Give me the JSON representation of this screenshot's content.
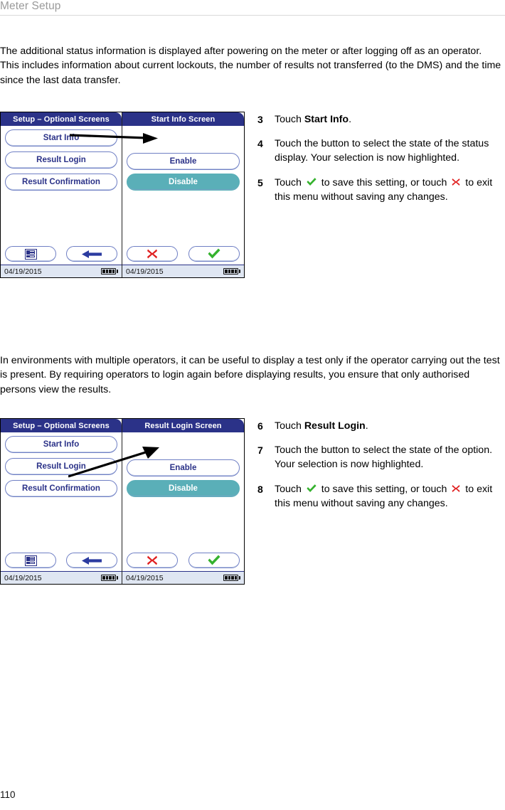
{
  "running_head": "Meter Setup",
  "page_number": "110",
  "paragraphs": {
    "intro": "The additional status information is displayed after powering on the meter or after logging off as an operator. This includes information about current lockouts, the number of results not transferred (to the DMS) and the time since the last data transfer.",
    "middle": "In environments with multiple operators, it can be useful to display a test only if the operator carrying out the test is present. By requiring operators to login again before displaying results, you ensure that only authorised persons view the results."
  },
  "colors": {
    "title_bar": "#2b3288",
    "selected_button": "#5aafb8",
    "button_border": "#6f7fc4",
    "status_bar": "#dfe6f2",
    "check_green": "#35b22e",
    "cross_red": "#e02020",
    "back_arrow_blue": "#2b3ba0"
  },
  "device_1": {
    "left_screen": {
      "title": "Setup – Optional Screens",
      "menu_items": [
        {
          "label": "Start Info",
          "selected": false
        },
        {
          "label": "Result Login",
          "selected": false
        },
        {
          "label": "Result Confirmation",
          "selected": false
        }
      ],
      "footer_buttons": [
        {
          "icon": "list-icon"
        },
        {
          "icon": "back-arrow-icon"
        }
      ],
      "status": {
        "date": "04/19/2015",
        "battery": "battery-full-icon"
      }
    },
    "right_screen": {
      "title": "Start Info Screen",
      "options": [
        {
          "label": "Enable",
          "selected": false
        },
        {
          "label": "Disable",
          "selected": true
        }
      ],
      "footer_buttons": [
        {
          "icon": "cross-icon"
        },
        {
          "icon": "check-icon"
        }
      ],
      "status": {
        "date": "04/19/2015",
        "battery": "battery-full-icon"
      }
    }
  },
  "device_2": {
    "left_screen": {
      "title": "Setup – Optional Screens",
      "menu_items": [
        {
          "label": "Start Info",
          "selected": false
        },
        {
          "label": "Result Login",
          "selected": false
        },
        {
          "label": "Result Confirmation",
          "selected": false
        }
      ],
      "footer_buttons": [
        {
          "icon": "list-icon"
        },
        {
          "icon": "back-arrow-icon"
        }
      ],
      "status": {
        "date": "04/19/2015",
        "battery": "battery-full-icon"
      }
    },
    "right_screen": {
      "title": "Result Login Screen",
      "options": [
        {
          "label": "Enable",
          "selected": false
        },
        {
          "label": "Disable",
          "selected": true
        }
      ],
      "footer_buttons": [
        {
          "icon": "cross-icon"
        },
        {
          "icon": "check-icon"
        }
      ],
      "status": {
        "date": "04/19/2015",
        "battery": "battery-full-icon"
      }
    }
  },
  "steps_1": [
    {
      "num": "3",
      "parts": [
        {
          "t": "Touch "
        },
        {
          "t": "Start Info",
          "bold": true
        },
        {
          "t": "."
        }
      ]
    },
    {
      "num": "4",
      "parts": [
        {
          "t": "Touch the button to select the state of the status display. Your selection is now highlighted."
        }
      ]
    },
    {
      "num": "5",
      "parts": [
        {
          "t": "Touch "
        },
        {
          "icon": "check-icon"
        },
        {
          "t": " to save this setting, or touch "
        },
        {
          "icon": "cross-icon"
        },
        {
          "t": " to exit this menu without saving any changes."
        }
      ]
    }
  ],
  "steps_2": [
    {
      "num": "6",
      "parts": [
        {
          "t": "Touch "
        },
        {
          "t": "Result Login",
          "bold": true
        },
        {
          "t": "."
        }
      ]
    },
    {
      "num": "7",
      "parts": [
        {
          "t": "Touch the button to select the state of the option. Your selection is now highlighted."
        }
      ]
    },
    {
      "num": "8",
      "parts": [
        {
          "t": "Touch "
        },
        {
          "icon": "check-icon"
        },
        {
          "t": " to save this setting, or touch "
        },
        {
          "icon": "cross-icon"
        },
        {
          "t": " to exit this menu without saving any changes."
        }
      ]
    }
  ]
}
